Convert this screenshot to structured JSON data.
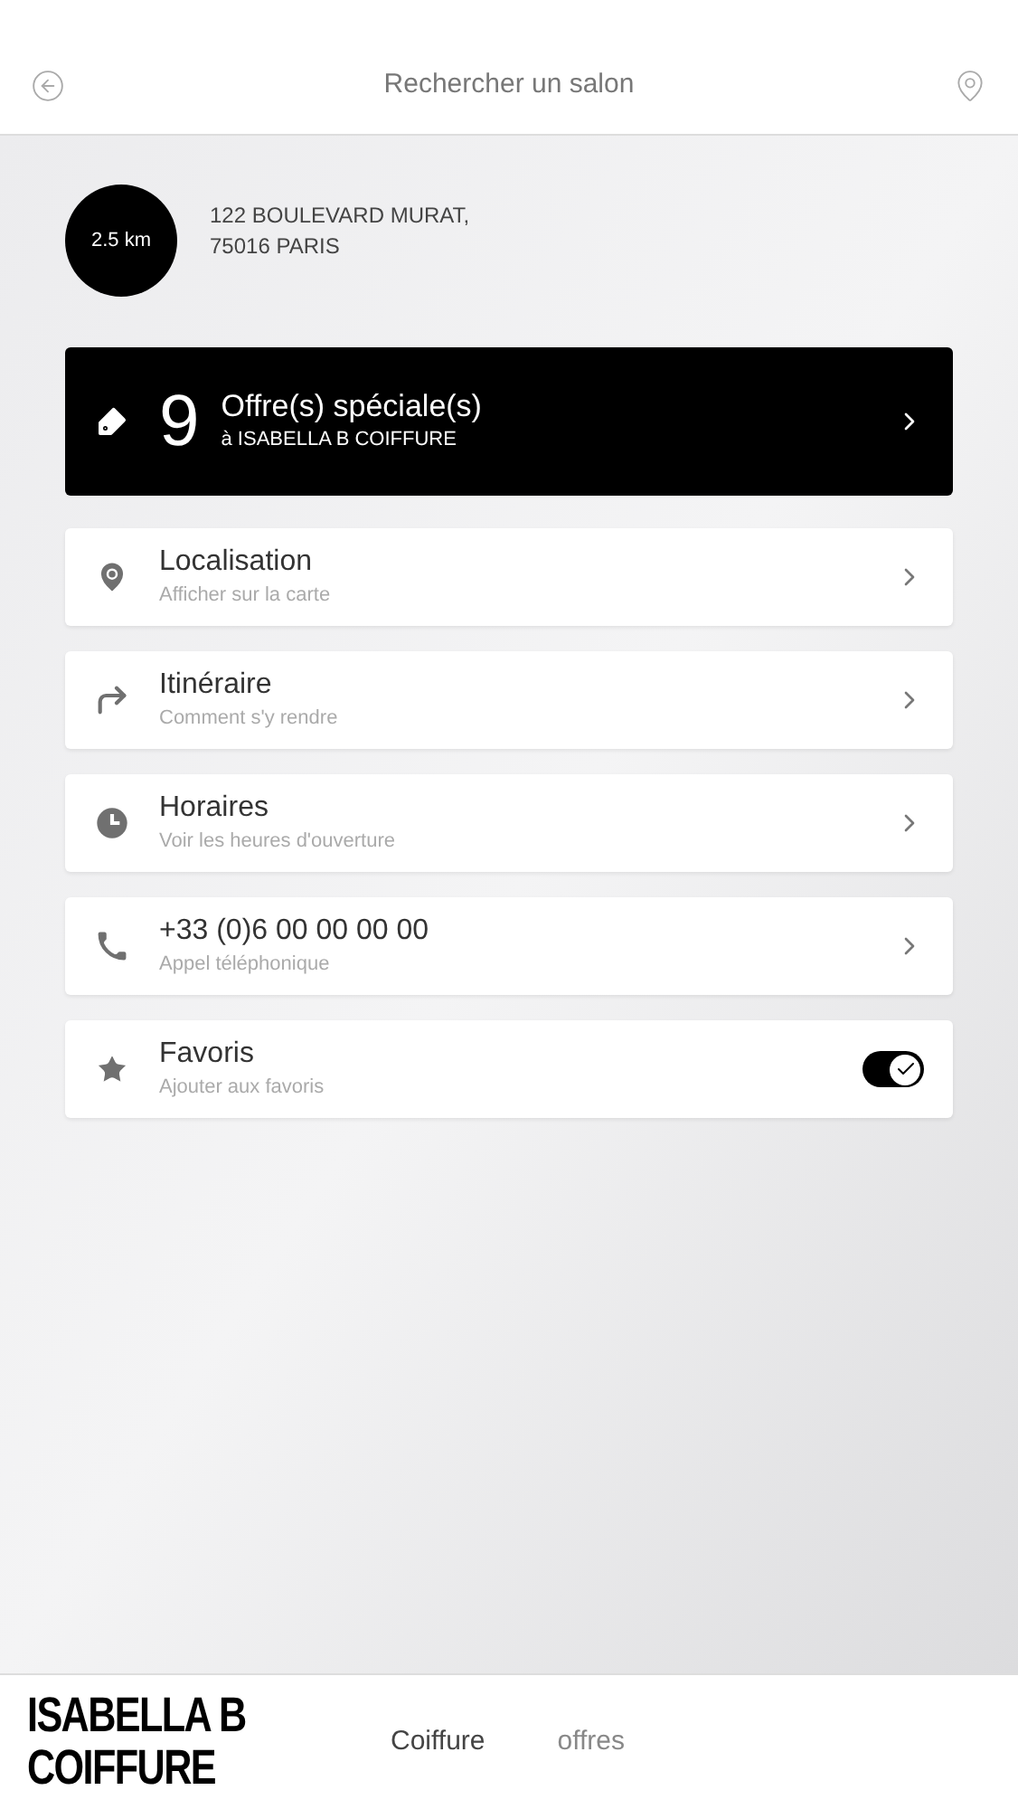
{
  "header": {
    "title": "Rechercher un salon"
  },
  "salon": {
    "distance": "2.5 km",
    "address_lines": [
      "122 BOULEVARD MURAT,",
      "75016 PARIS"
    ]
  },
  "offers": {
    "count": "9",
    "title": "Offre(s) spéciale(s)",
    "subtitle": "à ISABELLA B COIFFURE"
  },
  "rows": [
    {
      "kind": "link",
      "title": "Localisation",
      "subtitle": "Afficher sur la carte"
    },
    {
      "kind": "link",
      "title": "Itinéraire",
      "subtitle": "Comment s'y rendre"
    },
    {
      "kind": "link",
      "title": "Horaires",
      "subtitle": "Voir les heures d'ouverture"
    },
    {
      "kind": "link",
      "title": "+33 (0)6 00 00 00 00",
      "subtitle": "Appel téléphonique"
    },
    {
      "kind": "toggle",
      "title": "Favoris",
      "subtitle": "Ajouter aux favoris",
      "on": true
    }
  ],
  "footer": {
    "logo_lines": [
      "ISABELLA B",
      "COIFFURE"
    ],
    "tabs": [
      {
        "label": "Coiffure",
        "selected": true
      },
      {
        "label": "offres",
        "selected": false
      }
    ]
  }
}
